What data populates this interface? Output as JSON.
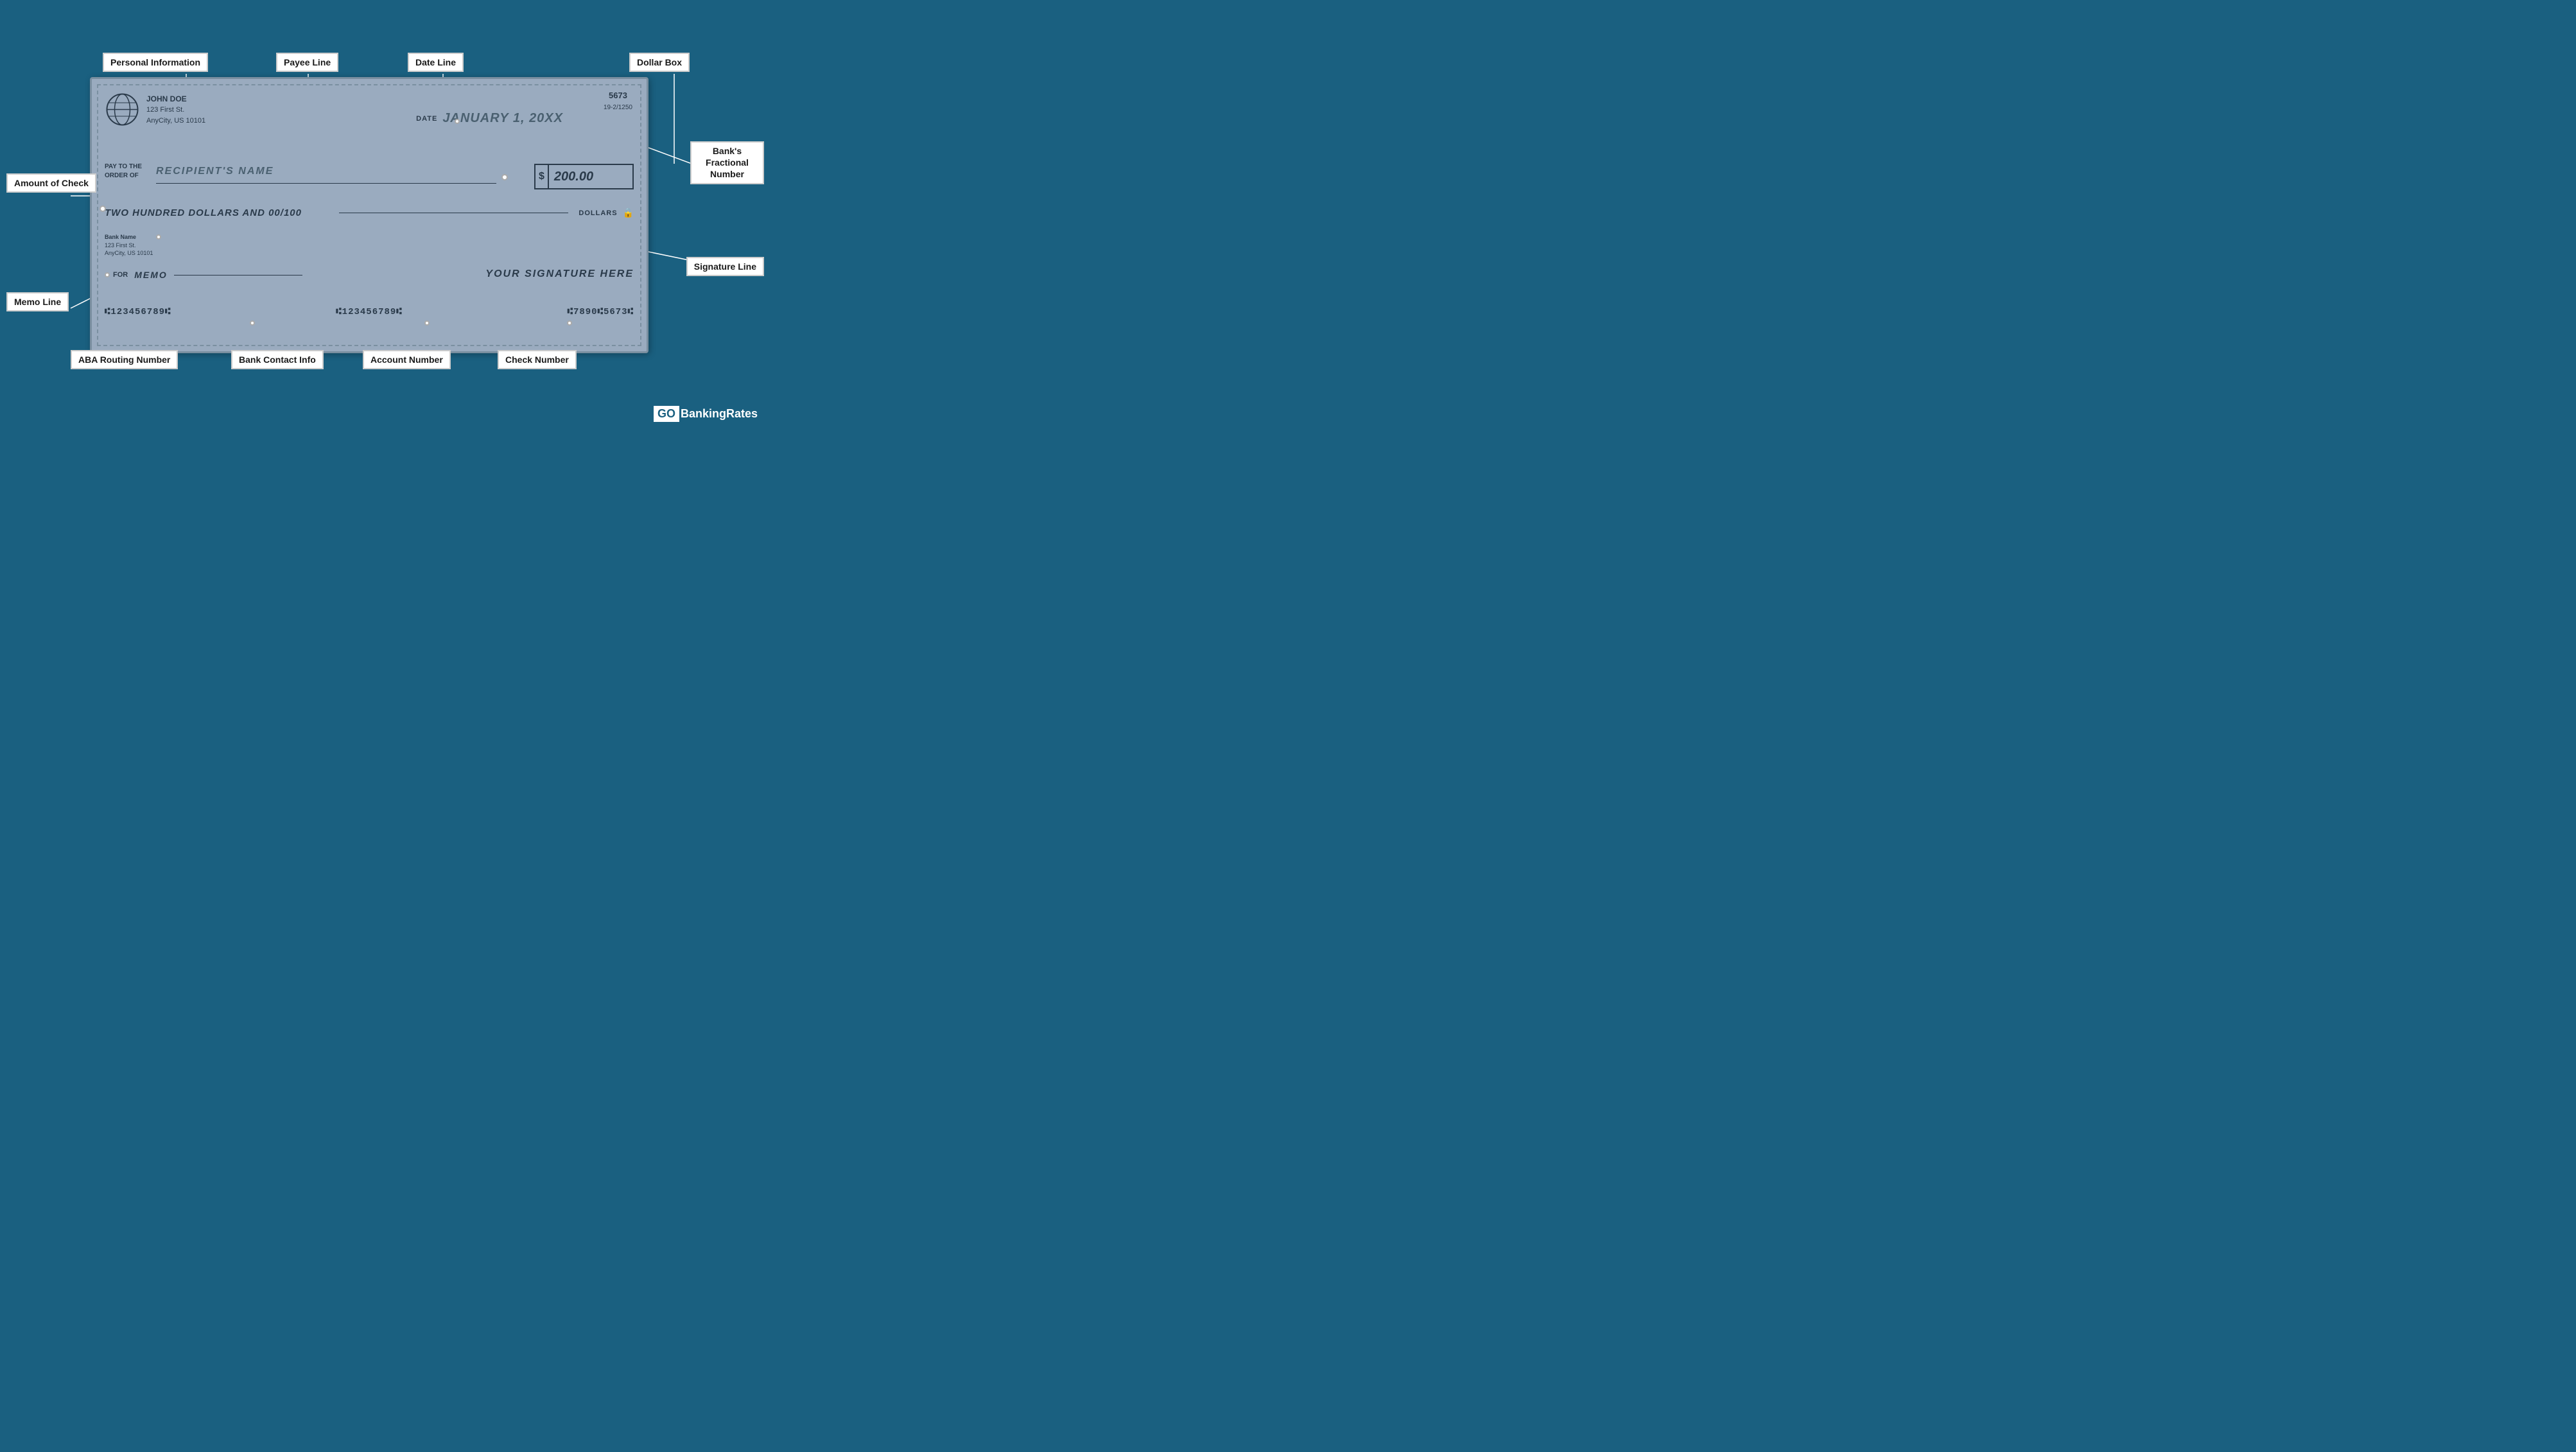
{
  "background_color": "#1a6080",
  "check": {
    "number": "5673",
    "fractional": "19-2/1250",
    "owner_name": "JOHN DOE",
    "owner_address_1": "123 First St.",
    "owner_city": "AnyCity, US 10101",
    "date_label": "DATE",
    "date_value": "JANUARY 1, 20XX",
    "pay_to_label_1": "PAY TO THE",
    "pay_to_label_2": "ORDER OF",
    "payee_name": "RECIPIENT'S NAME",
    "dollar_sign": "$",
    "dollar_amount": "200.00",
    "written_amount": "TWO HUNDRED DOLLARS AND 00/100",
    "dollars_label": "DOLLARS",
    "bank_name": "Bank Name",
    "bank_address_1": "123 First St.",
    "bank_city": "AnyCity, US 10101",
    "memo_label": "FOR",
    "memo_value": "MEMO",
    "signature_text": "YOUR SIGNATURE HERE",
    "micr_routing": "⑆123456789⑆",
    "micr_account": "⑆123456789⑆",
    "micr_check": "⑆7890⑆5673⑆"
  },
  "labels": {
    "personal_information": "Personal Information",
    "payee_line": "Payee Line",
    "date_line": "Date Line",
    "dollar_box": "Dollar Box",
    "amount_of_check": "Amount of Check",
    "memo_line": "Memo Line",
    "aba_routing_number": "ABA Routing Number",
    "bank_contact_info": "Bank Contact Info",
    "account_number": "Account Number",
    "check_number": "Check Number",
    "banks_fractional_number_1": "Bank's",
    "banks_fractional_number_2": "Fractional",
    "banks_fractional_number_3": "Number",
    "signature_line": "Signature Line"
  },
  "logo": {
    "go": "GO",
    "banking_rates": "BankingRates"
  }
}
